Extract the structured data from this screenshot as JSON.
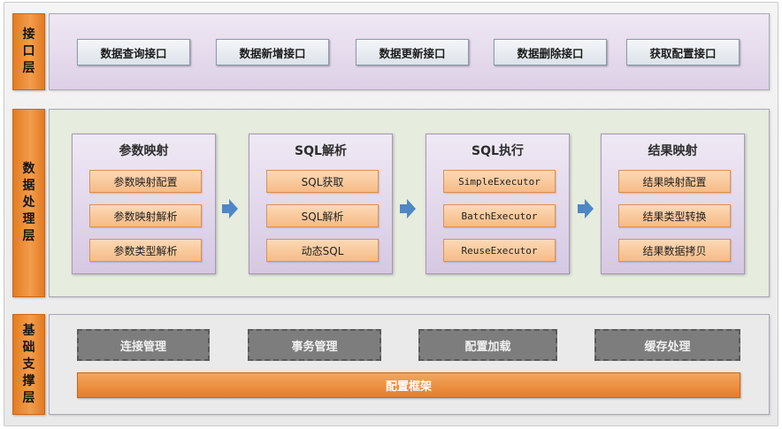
{
  "layers": {
    "interface": {
      "label_chars": [
        "接",
        "口",
        "层"
      ],
      "items": [
        "数据查询接口",
        "数据新增接口",
        "数据更新接口",
        "数据删除接口",
        "获取配置接口"
      ]
    },
    "processing": {
      "label_chars": [
        "数",
        "据",
        "处",
        "理",
        "层"
      ],
      "modules": [
        {
          "title": "参数映射",
          "items": [
            "参数映射配置",
            "参数映射解析",
            "参数类型解析"
          ]
        },
        {
          "title": "SQL解析",
          "items": [
            "SQL获取",
            "SQL解析",
            "动态SQL"
          ]
        },
        {
          "title": "SQL执行",
          "items": [
            "SimpleExecutor",
            "BatchExecutor",
            "ReuseExecutor"
          ]
        },
        {
          "title": "结果映射",
          "items": [
            "结果映射配置",
            "结果类型转换",
            "结果数据拷贝"
          ]
        }
      ]
    },
    "foundation": {
      "label_chars": [
        "基",
        "础",
        "支",
        "撑",
        "层"
      ],
      "items": [
        "连接管理",
        "事务管理",
        "配置加载",
        "缓存处理"
      ],
      "framework": "配置框架"
    }
  },
  "colors": {
    "layer_label": "#f29d4d",
    "interface_panel": "#ddd0e6",
    "processing_panel": "#e6ecde",
    "module_sub_box": "#f7bb86",
    "arrow": "#4f86c6",
    "foundation_box": "#7d7d7d",
    "framework_bar": "#e67d2a"
  }
}
